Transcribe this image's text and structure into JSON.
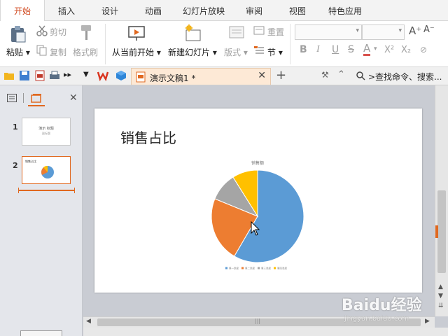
{
  "ribbon_tabs": [
    {
      "label": "开始",
      "active": true
    },
    {
      "label": "插入"
    },
    {
      "label": "设计"
    },
    {
      "label": "动画"
    },
    {
      "label": "幻灯片放映"
    },
    {
      "label": "审阅"
    },
    {
      "label": "视图"
    },
    {
      "label": "特色应用"
    }
  ],
  "ribbon": {
    "paste": "粘贴",
    "cut": "剪切",
    "copy": "复制",
    "format_painter": "格式刷",
    "play_from_current": "从当前开始",
    "new_slide": "新建幻灯片",
    "layout": "版式",
    "reset": "重置",
    "section": "节",
    "bold": "B",
    "italic": "I",
    "underline": "U",
    "strike": "S",
    "font_color": "A",
    "superscript": "X²",
    "subscript": "X₂",
    "grow_font": "A⁺",
    "shrink_font": "A⁻"
  },
  "quickbar": {
    "doc_title": "演示文稿1 *",
    "search": ">查找命令、搜索..."
  },
  "slides_panel": {
    "thumbs": [
      {
        "num": "1",
        "line1": "演示 标题",
        "line2": "副标题"
      },
      {
        "num": "2",
        "line1": "销售占比"
      }
    ]
  },
  "slide": {
    "title": "销售占比"
  },
  "chart_data": {
    "type": "pie",
    "title": "销售额",
    "categories": [
      "第一季度",
      "第二季度",
      "第三季度",
      "第四季度"
    ],
    "values": [
      59,
      23,
      10,
      9
    ],
    "colors": [
      "#5b9bd5",
      "#ed7d31",
      "#a5a5a5",
      "#ffc000"
    ],
    "legend_position": "bottom"
  },
  "watermark": {
    "brand": "Baidu经验",
    "url": "jingyan.baidu.com"
  }
}
